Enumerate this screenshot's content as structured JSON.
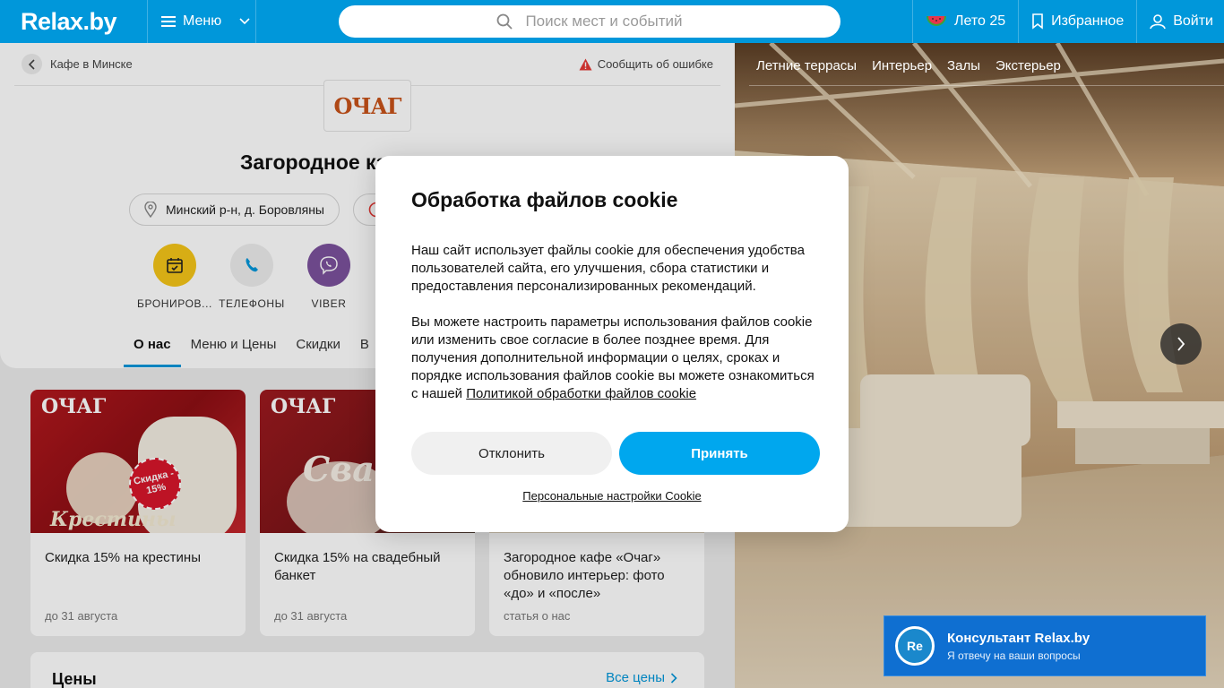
{
  "header": {
    "logo": "Relax.by",
    "menu_label": "Меню",
    "search_placeholder": "Поиск мест и событий",
    "summer_label": "Лето 25",
    "favorites_label": "Избранное",
    "login_label": "Войти"
  },
  "venue": {
    "breadcrumb": "Кафе в Минске",
    "report_error": "Сообщить об ошибке",
    "logo_text": "ОЧАГ",
    "title_visible": "Загородное ка",
    "address": "Минский р-н, д. Боровляны",
    "quick_actions": [
      {
        "label": "БРОНИРОВ..."
      },
      {
        "label": "ТЕЛЕФОНЫ"
      },
      {
        "label": "VIBER"
      }
    ],
    "tabs": [
      {
        "label": "О нас"
      },
      {
        "label": "Меню и Цены"
      },
      {
        "label": "Скидки"
      },
      {
        "label": "В"
      }
    ]
  },
  "promos": [
    {
      "title": "Скидка 15% на крестины",
      "footer": "до 31 августа",
      "img_logo": "ОЧАГ",
      "img_caption": "Крестины",
      "badge": "Скидка - 15%"
    },
    {
      "title": "Скидка 15% на свадебный банкет",
      "footer": "до 31 августа",
      "img_logo": "ОЧАГ",
      "img_caption": "Сва"
    },
    {
      "title": "Загородное кафе «Очаг» обновило интерьер: фото «до» и «после»",
      "footer": "статья о нас"
    }
  ],
  "prices": {
    "title": "Цены",
    "all_link": "Все цены"
  },
  "photo_tabs": [
    {
      "label": "Летние террасы"
    },
    {
      "label": "Интерьер"
    },
    {
      "label": "Залы"
    },
    {
      "label": "Экстерьер"
    }
  ],
  "consultant": {
    "avatar": "Re",
    "title": "Консультант Relax.by",
    "subtitle": "Я отвечу на ваши вопросы"
  },
  "cookie_modal": {
    "title": "Обработка файлов cookie",
    "para1": "Наш сайт использует файлы cookie для обеспечения удобства пользователей сайта, его улучшения, сбора статистики и предоставления персонализированных рекомендаций.",
    "para2": "Вы можете настроить параметры использования файлов cookie или изменить свое согласие в более позднее время. Для получения дополнительной информации о целях, сроках и порядке использования файлов cookie вы можете ознакомиться с нашей ",
    "policy_link": "Политикой обработки файлов cookie",
    "decline": "Отклонить",
    "accept": "Принять",
    "settings_link": "Персональные настройки Cookie"
  },
  "colors": {
    "brand": "#0097da",
    "accept": "#00a7ee",
    "consultant": "#0f6fd1"
  }
}
